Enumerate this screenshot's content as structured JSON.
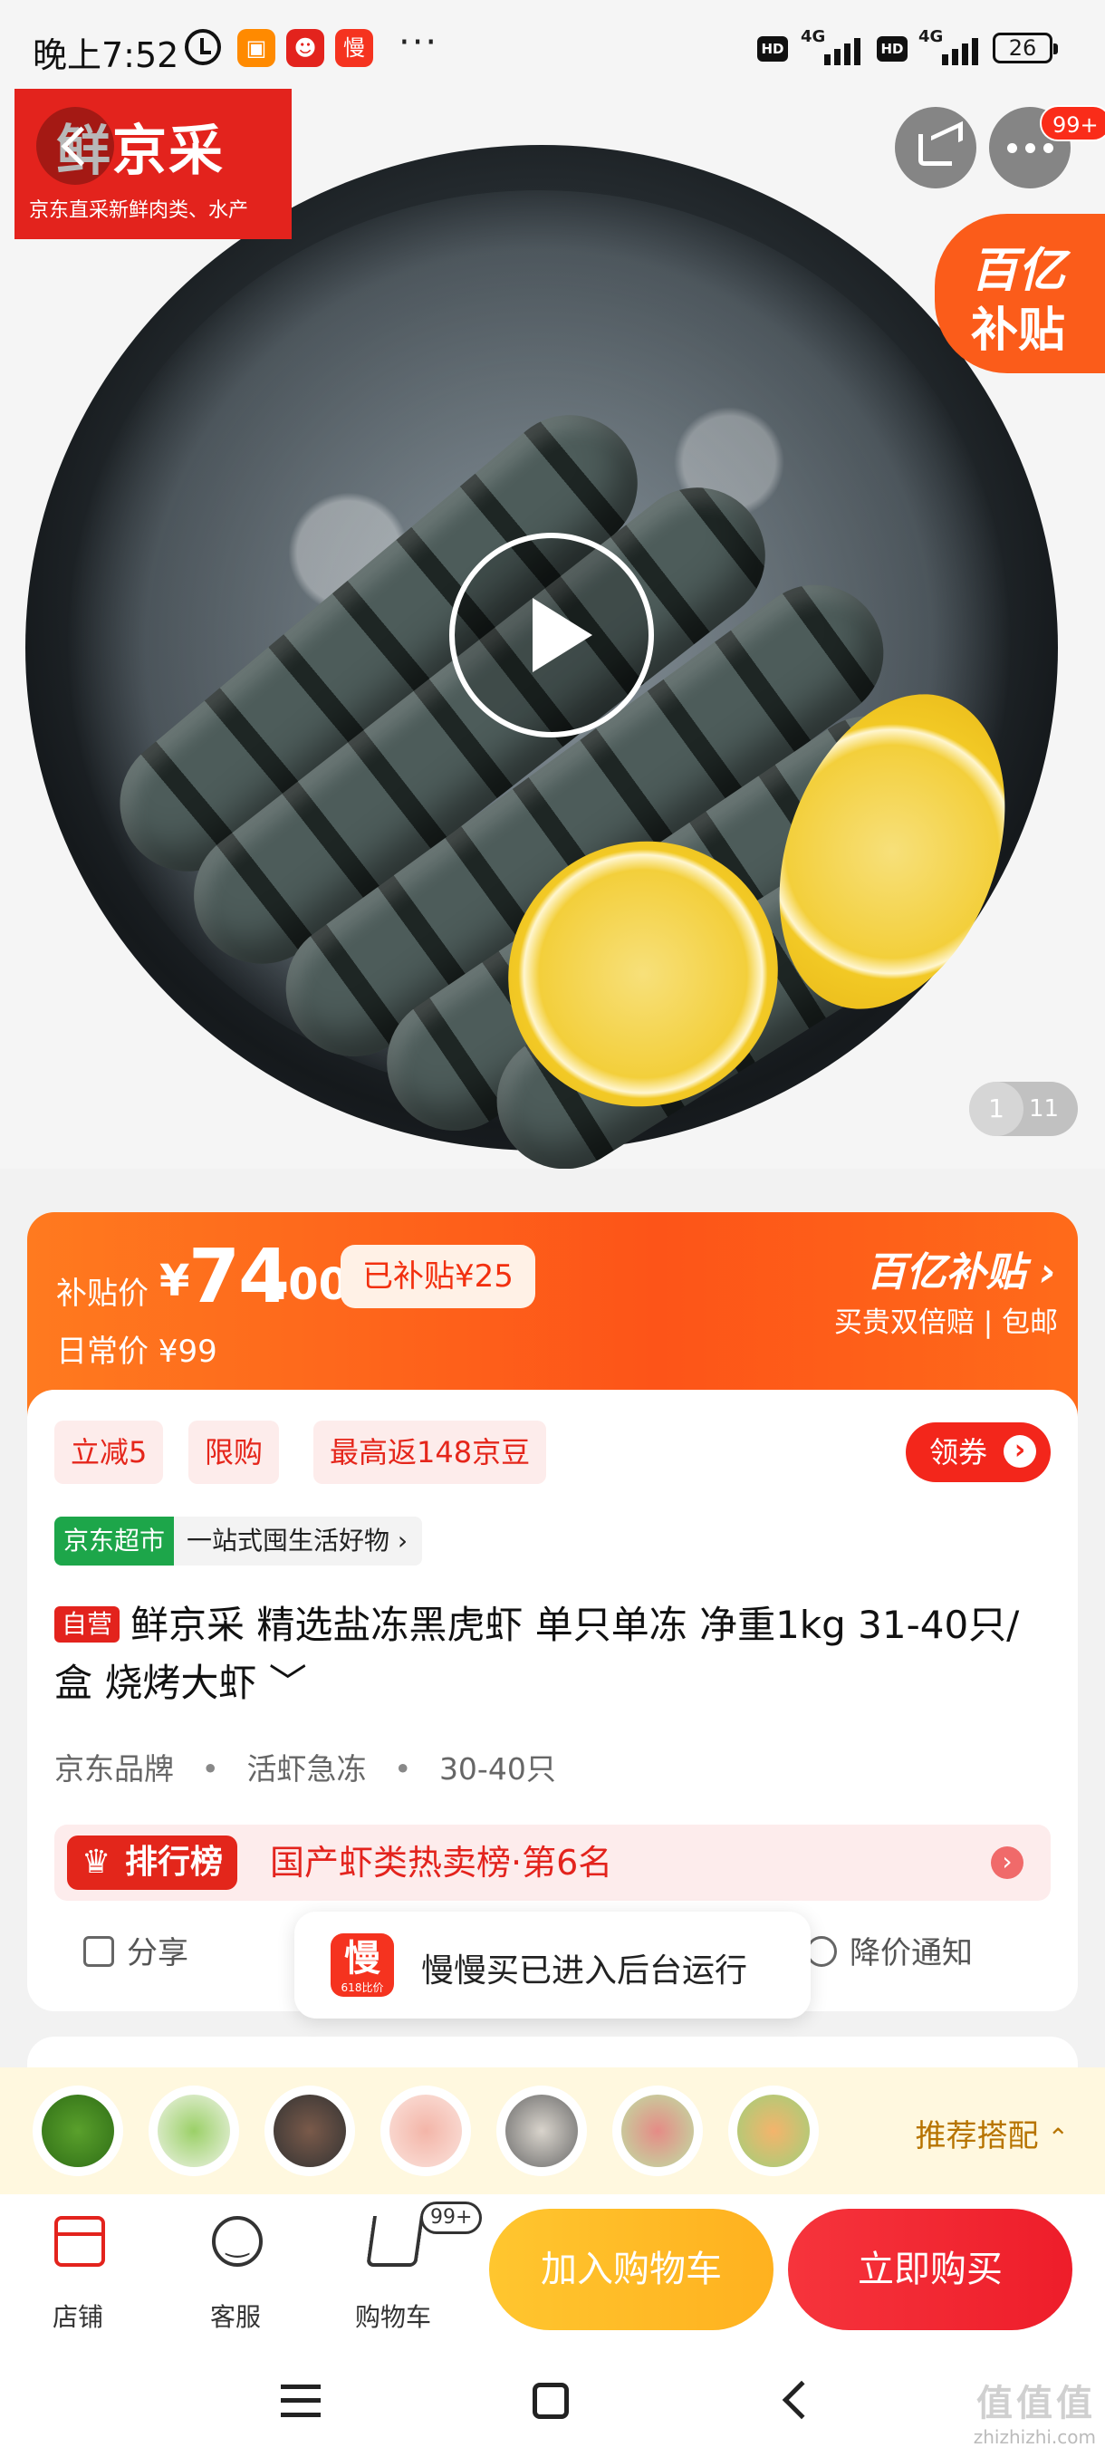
{
  "status_bar": {
    "time": "晚上7:52",
    "network1": "4G",
    "network2": "4G",
    "hd": "HD",
    "battery": "26",
    "app_icon_label": "慢"
  },
  "hero": {
    "brand_main": "鲜京采",
    "brand_sub": "京东直采新鲜肉类、水产",
    "more_badge": "99+",
    "subsidy_line1": "百亿",
    "subsidy_line2": "补贴",
    "pager_current": "1",
    "pager_total": "11"
  },
  "price": {
    "label": "补贴价",
    "currency": "¥",
    "integer": "74",
    "decimal": ".00",
    "subsidized_tag": "已补贴¥25",
    "daily_price": "日常价 ¥99",
    "program": "百亿补贴 ›",
    "program_sub": "买贵双倍赔 | 包邮"
  },
  "promos": {
    "items": [
      "立减5",
      "限购",
      "最高返148京豆"
    ],
    "coupon": "领券"
  },
  "store": {
    "tag": "京东超市",
    "slogan": "一站式囤生活好物 ›"
  },
  "product": {
    "self_tag": "自营",
    "title": "鲜京采 精选盐冻黑虎虾 单只单冻 净重1kg 31-40只/盒 烧烤大虾 ﹀",
    "specs": [
      "京东品牌",
      "活虾急冻",
      "30-40只"
    ]
  },
  "rank": {
    "tag": "排行榜",
    "text": "国产虾类热卖榜·第6名"
  },
  "actions": {
    "share": "分享",
    "price_alert": "降价通知"
  },
  "toast": {
    "icon_text": "慢",
    "icon_sub": "618比价",
    "message": "慢慢买已进入后台运行"
  },
  "recommend": {
    "label": "推荐搭配"
  },
  "bottom_bar": {
    "store": "店铺",
    "service": "客服",
    "cart": "购物车",
    "cart_badge": "99+",
    "add_to_cart": "加入购物车",
    "buy_now": "立即购买"
  },
  "watermark": {
    "line1": "值值值",
    "line2": "zhizhizhi.com"
  },
  "colors": {
    "accent": "#e3231d",
    "subsidy_orange": "#fd5418",
    "cart_yellow": "#ffb11f",
    "buy_red": "#ee1d2a"
  }
}
